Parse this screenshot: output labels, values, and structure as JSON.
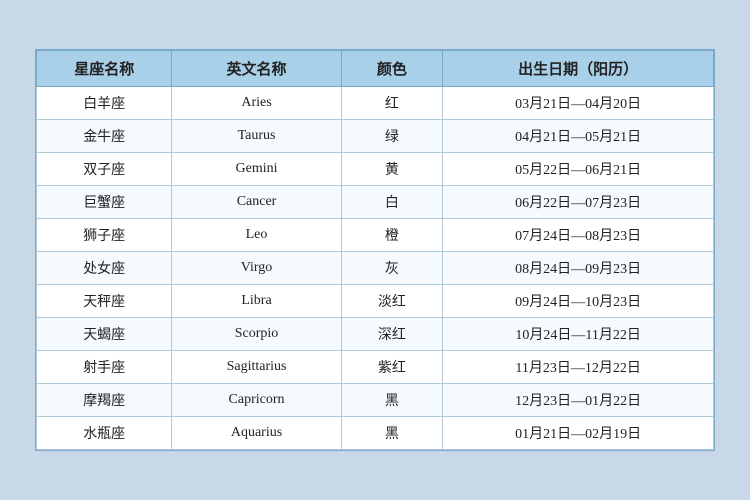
{
  "table": {
    "headers": {
      "chinese_name": "星座名称",
      "english_name": "英文名称",
      "color": "颜色",
      "birthdate": "出生日期（阳历）"
    },
    "rows": [
      {
        "cn": "白羊座",
        "en": "Aries",
        "color": "红",
        "date": "03月21日—04月20日"
      },
      {
        "cn": "金牛座",
        "en": "Taurus",
        "color": "绿",
        "date": "04月21日—05月21日"
      },
      {
        "cn": "双子座",
        "en": "Gemini",
        "color": "黄",
        "date": "05月22日—06月21日"
      },
      {
        "cn": "巨蟹座",
        "en": "Cancer",
        "color": "白",
        "date": "06月22日—07月23日"
      },
      {
        "cn": "狮子座",
        "en": "Leo",
        "color": "橙",
        "date": "07月24日—08月23日"
      },
      {
        "cn": "处女座",
        "en": "Virgo",
        "color": "灰",
        "date": "08月24日—09月23日"
      },
      {
        "cn": "天秤座",
        "en": "Libra",
        "color": "淡红",
        "date": "09月24日—10月23日"
      },
      {
        "cn": "天蝎座",
        "en": "Scorpio",
        "color": "深红",
        "date": "10月24日—11月22日"
      },
      {
        "cn": "射手座",
        "en": "Sagittarius",
        "color": "紫红",
        "date": "11月23日—12月22日"
      },
      {
        "cn": "摩羯座",
        "en": "Capricorn",
        "color": "黑",
        "date": "12月23日—01月22日"
      },
      {
        "cn": "水瓶座",
        "en": "Aquarius",
        "color": "黑",
        "date": "01月21日—02月19日"
      }
    ]
  }
}
